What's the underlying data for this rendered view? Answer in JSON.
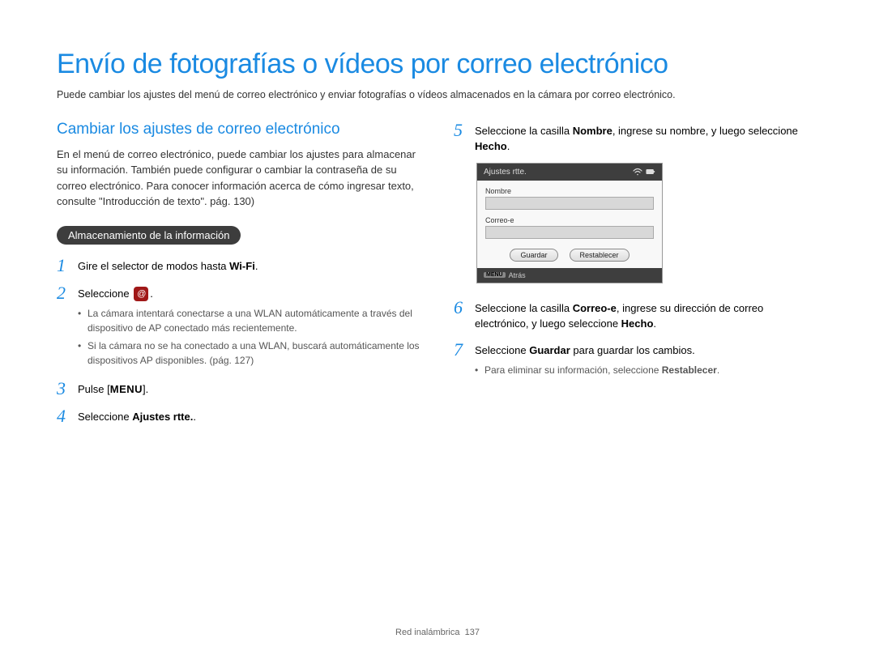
{
  "title": "Envío de fotografías o vídeos por correo electrónico",
  "intro": "Puede cambiar los ajustes del menú de correo electrónico y enviar fotografías o vídeos almacenados en la cámara por correo electrónico.",
  "section": {
    "title": "Cambiar los ajustes de correo electrónico",
    "intro": "En el menú de correo electrónico, puede cambiar los ajustes para almacenar su información. También puede configurar o cambiar la contraseña de su correo electrónico. Para conocer información acerca de cómo ingresar texto, consulte \"Introducción de texto\". pág. 130)",
    "pill": "Almacenamiento de la información"
  },
  "steps_left": {
    "s1": {
      "num": "1",
      "pre": "Gire el selector de modos hasta ",
      "wifi": "Wi-Fi",
      "post": "."
    },
    "s2": {
      "num": "2",
      "pre": "Seleccione ",
      "post": ".",
      "bullet1": "La cámara intentará conectarse a una WLAN automáticamente a través del dispositivo de AP conectado más recientemente.",
      "bullet2": "Si la cámara no se ha conectado a una WLAN, buscará automáticamente los dispositivos AP disponibles. (pág. 127)"
    },
    "s3": {
      "num": "3",
      "pre": "Pulse [",
      "menu": "MENU",
      "post": "]."
    },
    "s4": {
      "num": "4",
      "pre": "Seleccione ",
      "bold": "Ajustes rtte.",
      "post": "."
    }
  },
  "steps_right": {
    "s5": {
      "num": "5",
      "text_a": "Seleccione la casilla ",
      "bold_a": "Nombre",
      "text_b": ", ingrese su nombre, y luego seleccione ",
      "bold_b": "Hecho",
      "text_c": "."
    },
    "s6": {
      "num": "6",
      "text_a": "Seleccione la casilla ",
      "bold_a": "Correo-e",
      "text_b": ", ingrese su dirección de correo electrónico, y luego seleccione ",
      "bold_b": "Hecho",
      "text_c": "."
    },
    "s7": {
      "num": "7",
      "text_a": "Seleccione ",
      "bold_a": "Guardar",
      "text_b": " para guardar los cambios.",
      "bullet_a": "Para eliminar su información, seleccione ",
      "bullet_bold": "Restablecer",
      "bullet_post": "."
    }
  },
  "screen": {
    "header": "Ajustes rtte.",
    "label_name": "Nombre",
    "label_email": "Correo-e",
    "btn_save": "Guardar",
    "btn_reset": "Restablecer",
    "footer_menu": "MENU",
    "footer_back": "Atrás"
  },
  "footer": {
    "section": "Red inalámbrica",
    "page": "137"
  }
}
